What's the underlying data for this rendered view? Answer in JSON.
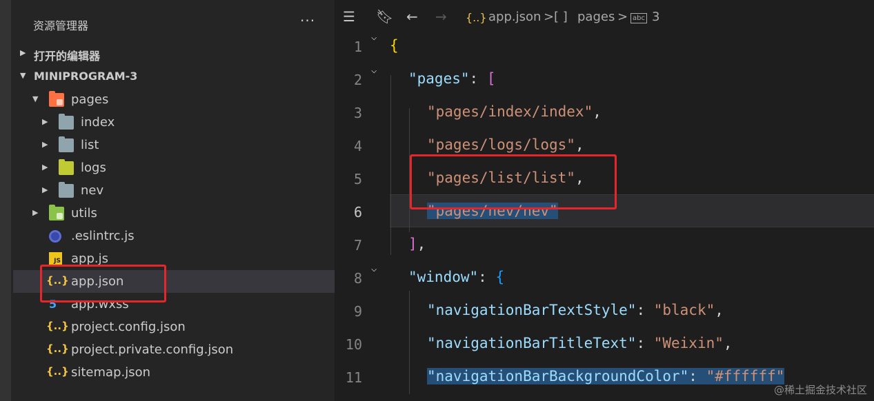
{
  "explorer": {
    "title": "资源管理器",
    "more": "···",
    "sections": {
      "open_editors": "打开的编辑器",
      "project": "MINIPROGRAM-3"
    },
    "tree": [
      {
        "name": "pages",
        "depth": 1,
        "kind": "folder-orange",
        "expanded": true
      },
      {
        "name": "index",
        "depth": 2,
        "kind": "folder-gray",
        "expanded": false
      },
      {
        "name": "list",
        "depth": 2,
        "kind": "folder-gray",
        "expanded": false
      },
      {
        "name": "logs",
        "depth": 2,
        "kind": "folder-green",
        "expanded": false
      },
      {
        "name": "nev",
        "depth": 2,
        "kind": "folder-gray",
        "expanded": false
      },
      {
        "name": "utils",
        "depth": 1,
        "kind": "folder-green",
        "expanded": false
      },
      {
        "name": ".eslintrc.js",
        "depth": 1,
        "kind": "eslint"
      },
      {
        "name": "app.js",
        "depth": 1,
        "kind": "js"
      },
      {
        "name": "app.json",
        "depth": 1,
        "kind": "json",
        "selected": true
      },
      {
        "name": "app.wxss",
        "depth": 1,
        "kind": "css"
      },
      {
        "name": "project.config.json",
        "depth": 1,
        "kind": "json"
      },
      {
        "name": "project.private.config.json",
        "depth": 1,
        "kind": "json"
      },
      {
        "name": "sitemap.json",
        "depth": 1,
        "kind": "json"
      }
    ]
  },
  "breadcrumb": {
    "file_icon": "{..}",
    "file": "app.json",
    "sep": ">",
    "array_icon": "[ ]",
    "key": "pages",
    "value_icon": "abc",
    "index": "3"
  },
  "editor": {
    "current_line": 6,
    "lines": [
      {
        "n": "1",
        "fold": true,
        "tokens": [
          [
            "b1",
            "{"
          ]
        ]
      },
      {
        "n": "2",
        "fold": true,
        "tokens": [
          [
            "k",
            "\"pages\""
          ],
          [
            "p",
            ": "
          ],
          [
            "b2",
            "["
          ]
        ]
      },
      {
        "n": "3",
        "tokens": [
          [
            "s",
            "\"pages/index/index\""
          ],
          [
            "p",
            ","
          ]
        ]
      },
      {
        "n": "4",
        "tokens": [
          [
            "s",
            "\"pages/logs/logs\""
          ],
          [
            "p",
            ","
          ]
        ]
      },
      {
        "n": "5",
        "tokens": [
          [
            "s",
            "\"pages/list/list\""
          ],
          [
            "p",
            ","
          ]
        ]
      },
      {
        "n": "6",
        "tokens": [
          [
            "s",
            "\"pages/nev/nev\""
          ]
        ]
      },
      {
        "n": "7",
        "tokens": [
          [
            "b2",
            "]"
          ],
          [
            "p",
            ","
          ]
        ]
      },
      {
        "n": "8",
        "fold": true,
        "tokens": [
          [
            "k",
            "\"window\""
          ],
          [
            "p",
            ": "
          ],
          [
            "b3",
            "{"
          ]
        ]
      },
      {
        "n": "9",
        "tokens": [
          [
            "k",
            "\"navigationBarTextStyle\""
          ],
          [
            "p",
            ": "
          ],
          [
            "s",
            "\"black\""
          ],
          [
            "p",
            ","
          ]
        ]
      },
      {
        "n": "10",
        "tokens": [
          [
            "k",
            "\"navigationBarTitleText\""
          ],
          [
            "p",
            ": "
          ],
          [
            "s",
            "\"Weixin\""
          ],
          [
            "p",
            ","
          ]
        ]
      },
      {
        "n": "11",
        "tokens": [
          [
            "k",
            "\"navigationBarBackgroundColor\""
          ],
          [
            "p",
            ": "
          ],
          [
            "s",
            "\"#ffffff\""
          ]
        ]
      }
    ]
  },
  "watermark": "@稀土掘金技术社区",
  "colors": {
    "annotation_red": "#e5262b",
    "string": "#ce9178",
    "key": "#9cdcfe"
  }
}
